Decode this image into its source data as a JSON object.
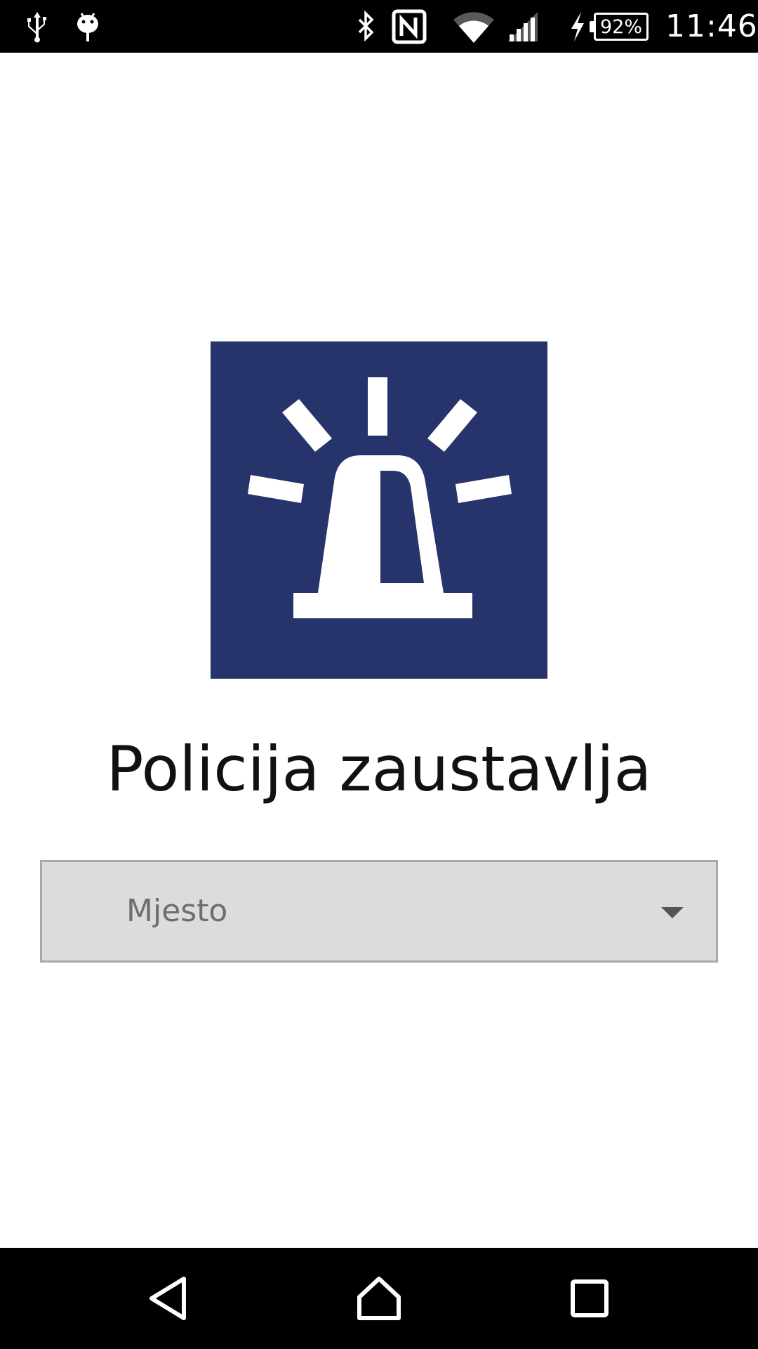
{
  "status_bar": {
    "icons": [
      "usb-icon",
      "android-debug-icon",
      "bluetooth-icon",
      "nfc-icon",
      "wifi-icon",
      "cell-signal-icon",
      "charging-icon"
    ],
    "battery_percent": "92%",
    "time": "11:46"
  },
  "app": {
    "logo_icon": "police-siren-icon",
    "logo_color": "#27336b",
    "title": "Policija zaustavlja"
  },
  "location_select": {
    "placeholder": "Mjesto"
  },
  "nav_bar": {
    "buttons": [
      "back-icon",
      "home-icon",
      "recents-icon"
    ]
  }
}
